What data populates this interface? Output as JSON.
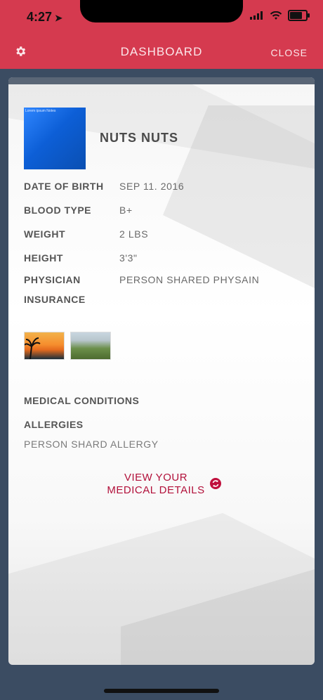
{
  "status_bar": {
    "time": "4:27",
    "location_icon": "location-arrow-icon",
    "icons": [
      "signal-icon",
      "wifi-icon",
      "battery-icon"
    ]
  },
  "navbar": {
    "title": "DASHBOARD",
    "close_label": "CLOSE",
    "settings_icon": "gear-icon"
  },
  "profile": {
    "name": "NUTS NUTS",
    "avatar_caption": "Lorem ipsum Notes",
    "fields": [
      {
        "label": "DATE OF BIRTH",
        "value": "SEP 11. 2016"
      },
      {
        "label": "BLOOD TYPE",
        "value": "B+"
      },
      {
        "label": "WEIGHT",
        "value": "2 LBS"
      },
      {
        "label": "HEIGHT",
        "value": "3'3\""
      },
      {
        "label": "PHYSICIAN",
        "value": "PERSON SHARED PHYSAIN"
      },
      {
        "label": "INSURANCE",
        "value": ""
      }
    ]
  },
  "photos": [
    {
      "name": "sunset-photo"
    },
    {
      "name": "landscape-photo"
    }
  ],
  "medical": {
    "conditions_title": "MEDICAL CONDITIONS",
    "allergies_title": "ALLERGIES",
    "allergies_value": "PERSON SHARD ALLERGY",
    "view_line1": "VIEW YOUR",
    "view_line2": "MEDICAL DETAILS"
  },
  "colors": {
    "accent_red": "#d53a4f",
    "link_red": "#b2103a",
    "background_navy": "#3b4c62"
  }
}
